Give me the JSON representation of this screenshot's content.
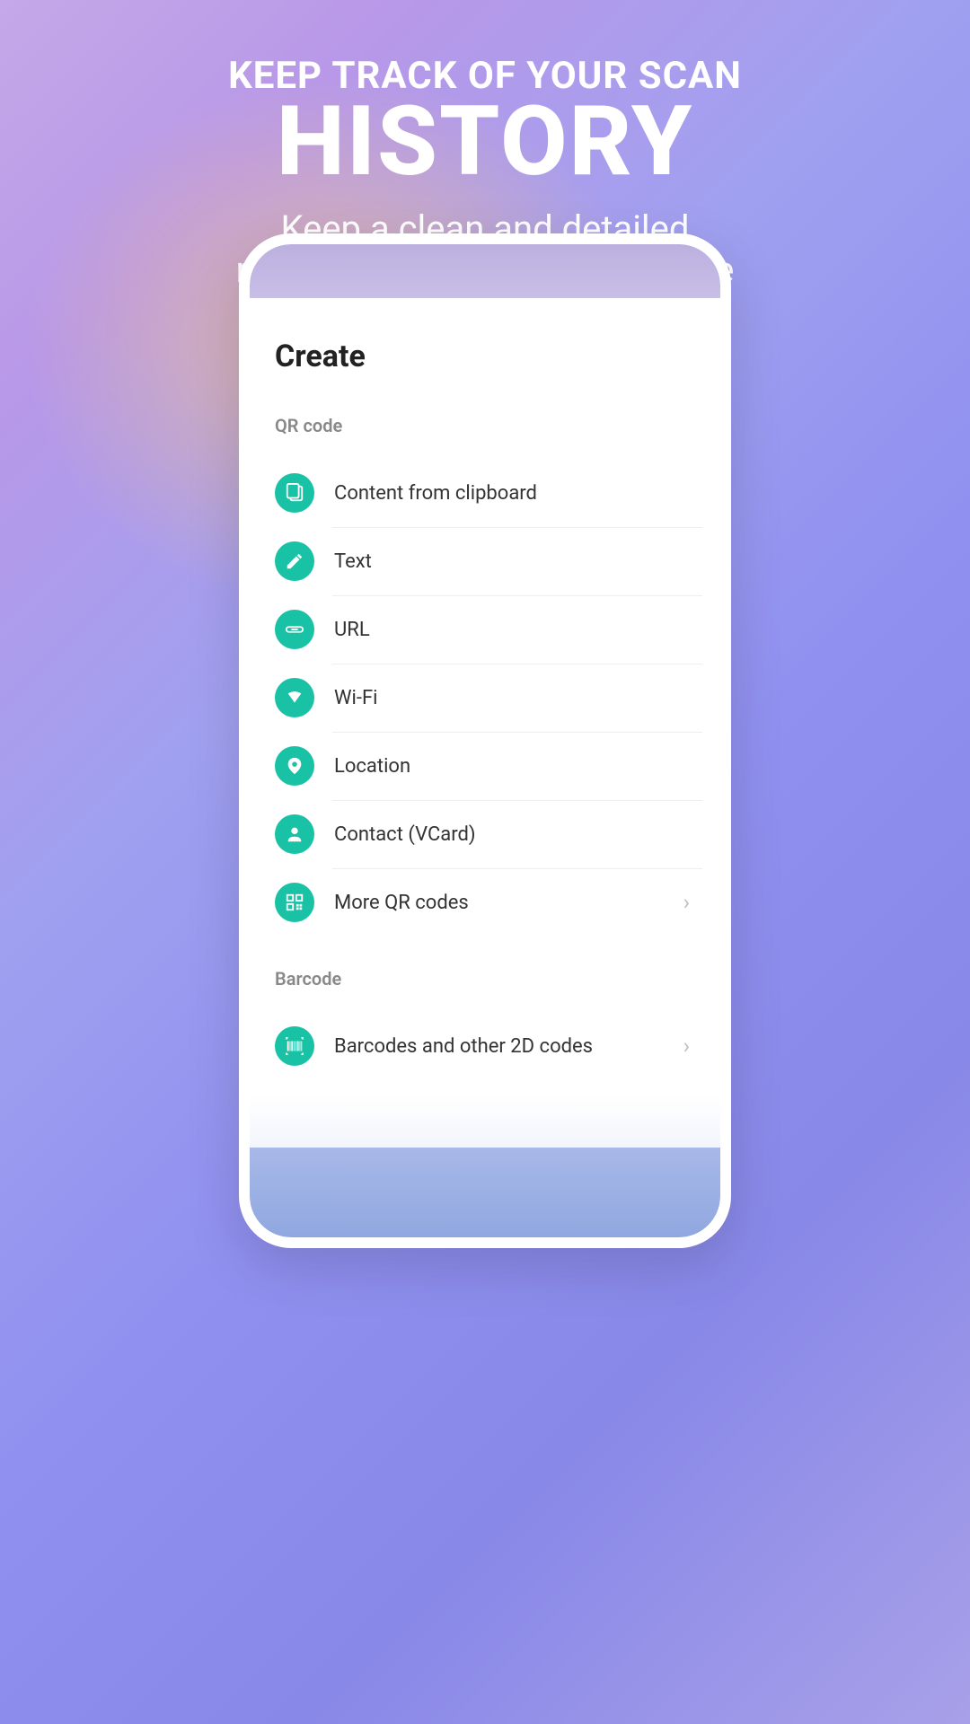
{
  "hero": {
    "line1": "KEEP TRACK OF YOUR SCAN",
    "line2": "HISTORY",
    "sub1": "Keep a clean and detailed",
    "sub2": "record for every scan you make"
  },
  "screen": {
    "title": "Create",
    "sections": {
      "qr": {
        "header": "QR code",
        "items": [
          {
            "icon": "clipboard",
            "label": "Content from clipboard",
            "chevron": false
          },
          {
            "icon": "pen",
            "label": "Text",
            "chevron": false
          },
          {
            "icon": "link",
            "label": "URL",
            "chevron": false
          },
          {
            "icon": "wifi",
            "label": "Wi-Fi",
            "chevron": false
          },
          {
            "icon": "location",
            "label": "Location",
            "chevron": false
          },
          {
            "icon": "contact",
            "label": "Contact (VCard)",
            "chevron": false
          },
          {
            "icon": "qr",
            "label": "More QR codes",
            "chevron": true
          }
        ]
      },
      "barcode": {
        "header": "Barcode",
        "items": [
          {
            "icon": "barcode",
            "label": "Barcodes and other 2D codes",
            "chevron": true
          }
        ]
      }
    }
  }
}
